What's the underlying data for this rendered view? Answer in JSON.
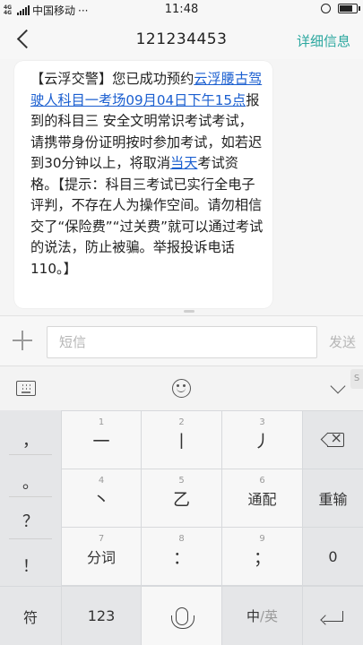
{
  "status_bar": {
    "network": "4G 4G",
    "carrier": "中国移动",
    "more": "···",
    "time": "11:48",
    "battery_level": 0.85
  },
  "header": {
    "title": "121234453",
    "detail_label": "详细信息"
  },
  "message": {
    "part1": "【云浮交警】您已成功预约",
    "link1": "云浮腰古驾驶人科目一考场09月04日下午15点",
    "part2": "报到的科目三 安全文明常识考试考试，请携带身份证明按时参加考试，如若迟到30分钟以上，将取消",
    "link2": "当天",
    "part3": "考试资格。【提示：科目三考试已实行全电子评判，不存在人为操作空间。请勿相信交了“保险费”“过关费”就可以通过考试的说法，防止被骗。举报投诉电话110。】"
  },
  "compose": {
    "placeholder": "短信",
    "send_label": "发送"
  },
  "keyboard": {
    "side_symbols": [
      "，",
      "。",
      "？",
      "！"
    ],
    "keys": [
      {
        "num": "1",
        "label": "一"
      },
      {
        "num": "2",
        "label": "丨"
      },
      {
        "num": "3",
        "label": "丿"
      },
      {
        "num": "4",
        "label": "丶"
      },
      {
        "num": "5",
        "label": "乙"
      },
      {
        "num": "6",
        "label": "通配"
      },
      {
        "num": "7",
        "label": "分词"
      },
      {
        "num": "8",
        "label": "："
      },
      {
        "num": "9",
        "label": "；"
      }
    ],
    "retype_label": "重输",
    "zero_label": "0",
    "symbol_label": "符",
    "num_label": "123",
    "lang_primary": "中",
    "lang_sep": "/",
    "lang_secondary": "英",
    "side_badge": "S"
  },
  "colors": {
    "accent": "#2ba79f",
    "link": "#1b5fd0"
  }
}
